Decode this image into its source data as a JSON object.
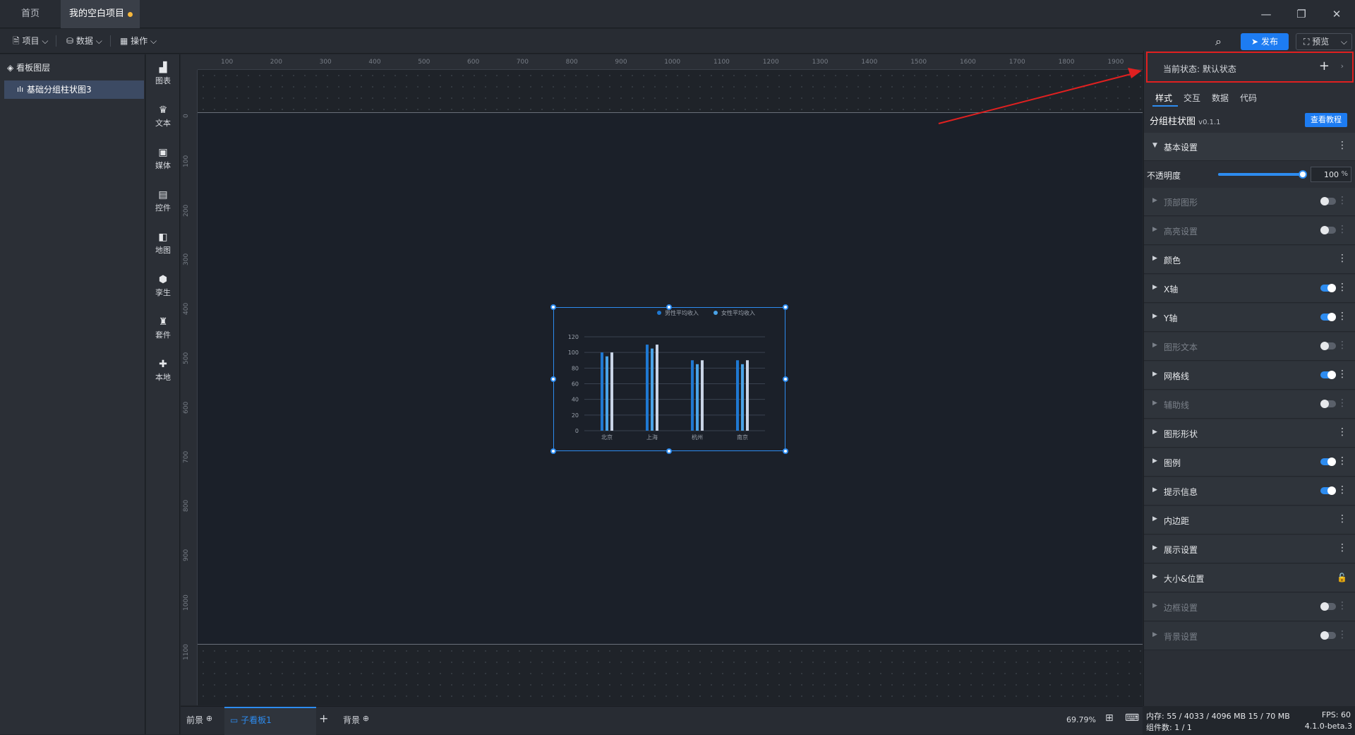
{
  "tabs": {
    "home": "首页",
    "project": "我的空白项目"
  },
  "toolbar": {
    "project": "项目",
    "data": "数据",
    "operate": "操作",
    "publish": "发布",
    "preview": "预览"
  },
  "layers": {
    "title": "看板图层",
    "item": "基础分组柱状图3"
  },
  "tools": [
    "图表",
    "文本",
    "媒体",
    "控件",
    "地图",
    "孪生",
    "套件",
    "本地"
  ],
  "ruler": {
    "h": [
      "100",
      "200",
      "300",
      "400",
      "500",
      "600",
      "700",
      "800",
      "900",
      "1000",
      "1100",
      "1200",
      "1300",
      "1400",
      "1500",
      "1600",
      "1700",
      "1800",
      "1900"
    ],
    "v": [
      "0",
      "100",
      "200",
      "300",
      "400",
      "500",
      "600",
      "700",
      "800",
      "900",
      "1000",
      "1100"
    ]
  },
  "chart_data": {
    "type": "bar",
    "categories": [
      "北京",
      "上海",
      "杭州",
      "南京"
    ],
    "series": [
      {
        "name": "男性平均收入",
        "values": [
          100,
          110,
          90,
          90
        ]
      },
      {
        "name": "",
        "values": [
          95,
          105,
          85,
          85
        ]
      },
      {
        "name": "女性平均收入",
        "values": [
          100,
          110,
          90,
          90
        ]
      }
    ],
    "ylim": [
      0,
      120
    ],
    "yticks": [
      "0",
      "20",
      "40",
      "60",
      "80",
      "100",
      "120"
    ],
    "colors": [
      "#1f78d1",
      "#4aa3e8",
      "#c9d4e6"
    ],
    "legend": "top-right",
    "grid": true
  },
  "bottom": {
    "foreground": "前景",
    "subboard": "子看板1",
    "background": "背景",
    "zoom": "69.79%"
  },
  "panel": {
    "state_label": "当前状态:",
    "state_value": "默认状态",
    "tabs": [
      "样式",
      "交互",
      "数据",
      "代码"
    ],
    "component": "分组柱状图",
    "version": "v0.1.1",
    "tutorial": "查看教程",
    "basic": "基本设置",
    "opacity_label": "不透明度",
    "opacity_value": "100",
    "opacity_unit": "%",
    "opacity": 100,
    "sections": [
      {
        "label": "顶部图形",
        "toggle": "off",
        "disabled": true
      },
      {
        "label": "高亮设置",
        "toggle": "off",
        "disabled": true
      },
      {
        "label": "颜色",
        "toggle": "none",
        "disabled": false
      },
      {
        "label": "X轴",
        "toggle": "on",
        "disabled": false
      },
      {
        "label": "Y轴",
        "toggle": "on",
        "disabled": false
      },
      {
        "label": "图形文本",
        "toggle": "off",
        "disabled": true
      },
      {
        "label": "网格线",
        "toggle": "on",
        "disabled": false
      },
      {
        "label": "辅助线",
        "toggle": "off",
        "disabled": true
      },
      {
        "label": "图形形状",
        "toggle": "none",
        "disabled": false
      },
      {
        "label": "图例",
        "toggle": "on",
        "disabled": false
      },
      {
        "label": "提示信息",
        "toggle": "on",
        "disabled": false
      },
      {
        "label": "内边距",
        "toggle": "none",
        "disabled": false
      },
      {
        "label": "展示设置",
        "toggle": "none",
        "disabled": false
      },
      {
        "label": "大小&位置",
        "toggle": "lock",
        "disabled": false
      },
      {
        "label": "边框设置",
        "toggle": "off",
        "disabled": true
      },
      {
        "label": "背景设置",
        "toggle": "off",
        "disabled": true
      }
    ]
  },
  "status": {
    "memory": "内存: 55 / 4033 / 4096 MB  15 / 70 MB",
    "fps": "FPS: 60",
    "components": "组件数: 1 / 1",
    "version": "4.1.0-beta.3"
  }
}
